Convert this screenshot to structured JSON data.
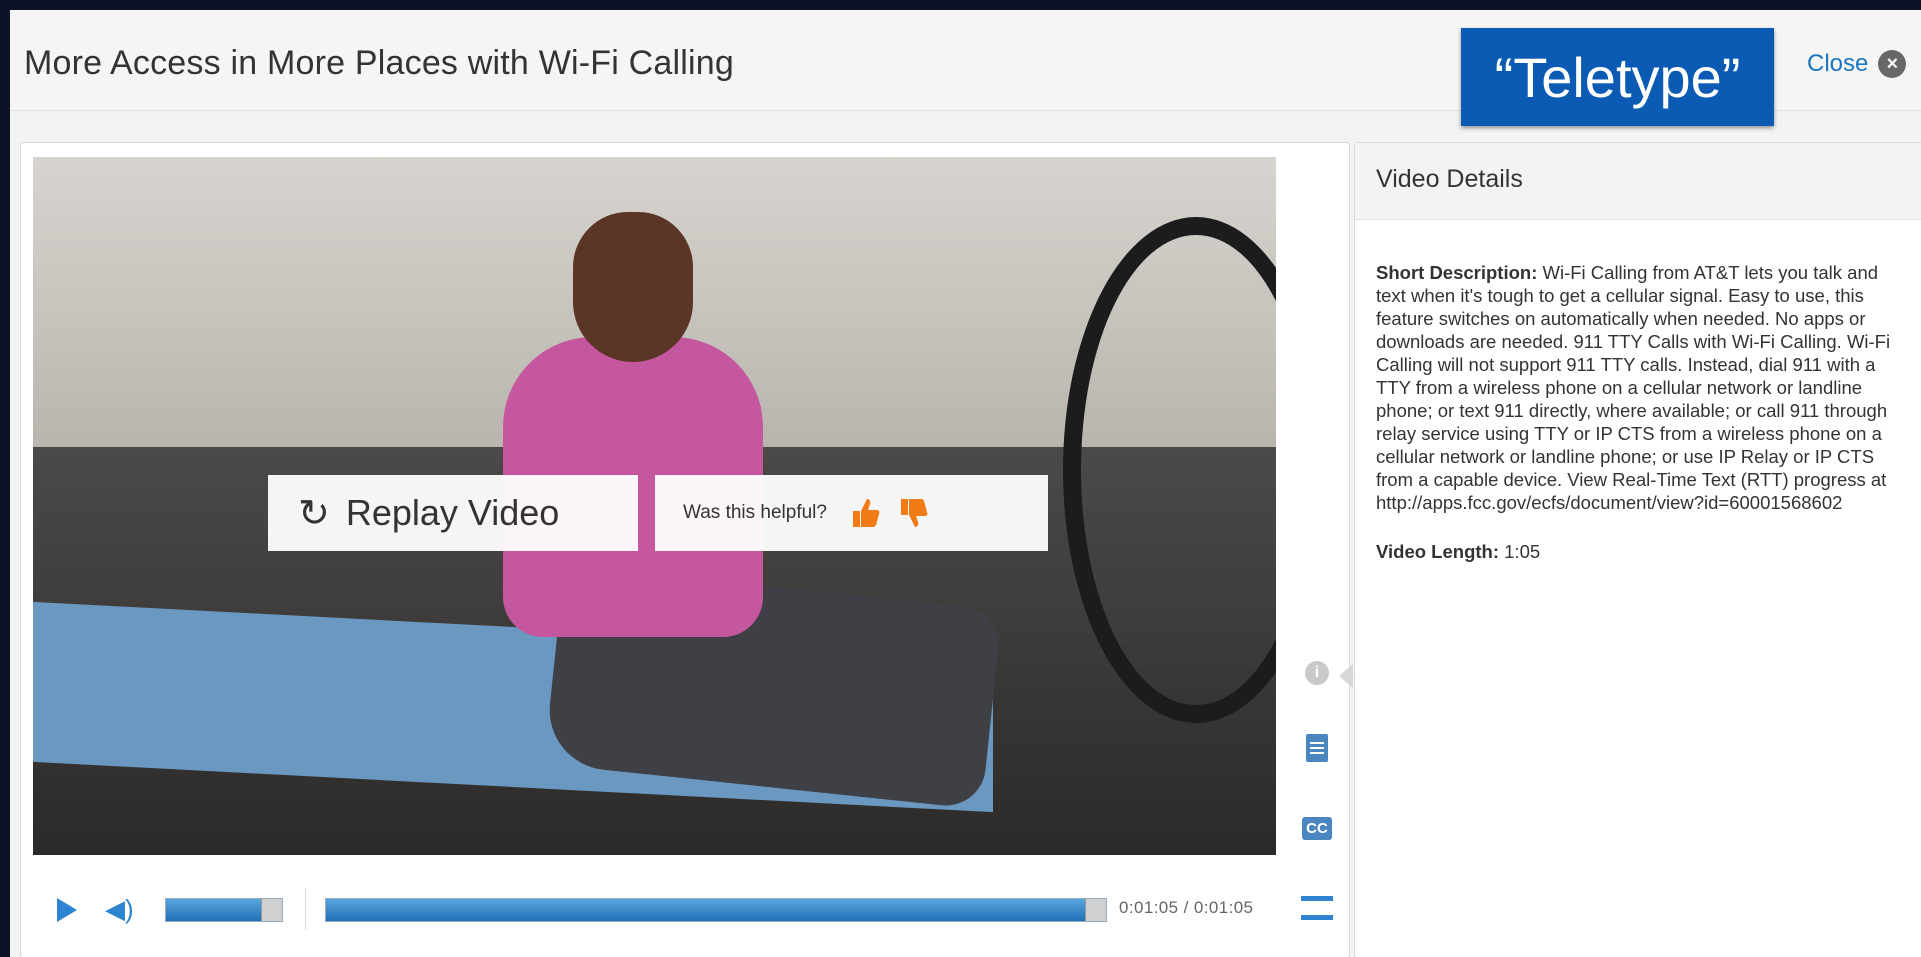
{
  "header": {
    "title": "More Access in More Places with Wi-Fi Calling",
    "close_label": "Close"
  },
  "annotation": {
    "text": "“Teletype”"
  },
  "video_overlay": {
    "replay_label": "Replay Video",
    "helpful_question": "Was this helpful?"
  },
  "sidebar": {
    "cc_label": "CC"
  },
  "controls": {
    "time_display": "0:01:05 / 0:01:05",
    "volume_level": 0.82,
    "progress": 1.0
  },
  "details": {
    "heading": "Video Details",
    "short_description_label": "Short Description:",
    "short_description": "Wi-Fi Calling from AT&T lets you talk and text when it's tough to get a cellular signal. Easy to use, this feature switches on automatically when needed. No apps or downloads are needed. 911 TTY Calls with Wi-Fi Calling. Wi-Fi Calling will not support 911 TTY calls. Instead, dial 911 with a TTY from a wireless phone on a cellular network or landline phone; or text 911 directly, where available; or call 911 through relay service using TTY or IP CTS from a wireless phone on a cellular network or landline phone; or use IP Relay or IP CTS from a capable device. View Real-Time Text (RTT) progress at http://apps.fcc.gov/ecfs/document/view?id=60001568602",
    "video_length_label": "Video Length:",
    "video_length": "1:05"
  },
  "colors": {
    "accent_blue": "#2d84d0",
    "annotation_bg": "#0b5bb5",
    "thumb_orange": "#f07a14",
    "link_blue": "#1a76c2"
  },
  "icons": [
    "close-icon",
    "replay-icon",
    "thumbs-up-icon",
    "thumbs-down-icon",
    "info-icon",
    "transcript-icon",
    "closed-captions-icon",
    "play-icon",
    "volume-icon",
    "fullscreen-icon"
  ]
}
